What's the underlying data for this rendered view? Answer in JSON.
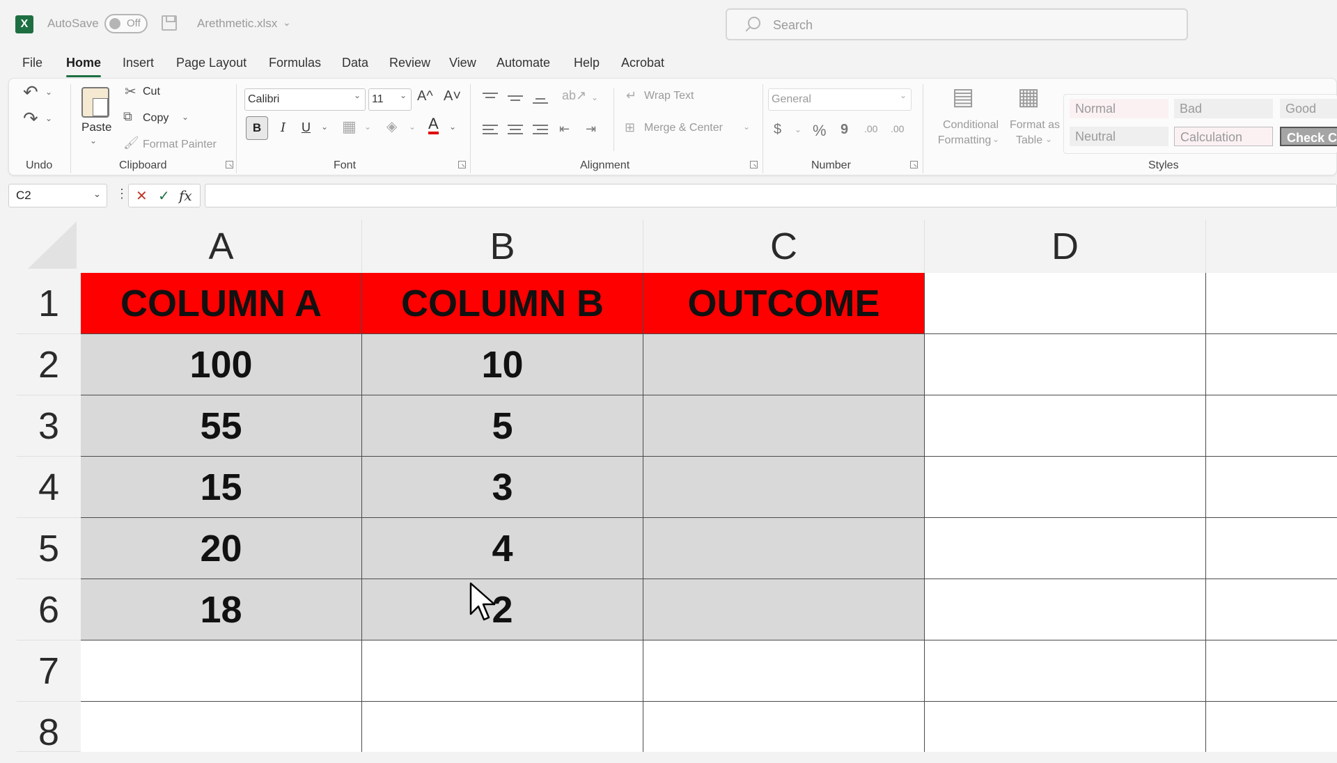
{
  "titlebar": {
    "app_icon_letter": "X",
    "autosave_label": "AutoSave",
    "autosave_state": "Off",
    "filename": "Arethmetic.xlsx",
    "search_placeholder": "Search"
  },
  "menu": {
    "tabs": [
      "File",
      "Home",
      "Insert",
      "Page Layout",
      "Formulas",
      "Data",
      "Review",
      "View",
      "Automate",
      "Help",
      "Acrobat"
    ],
    "active": "Home"
  },
  "ribbon": {
    "undo_group": "Undo",
    "clipboard": {
      "group": "Clipboard",
      "paste": "Paste",
      "cut": "Cut",
      "copy": "Copy",
      "format_painter": "Format Painter"
    },
    "font": {
      "group": "Font",
      "font_name": "Calibri",
      "font_size": "11",
      "bold": "B",
      "italic": "I",
      "underline": "U",
      "grow": "A^",
      "shrink": "A˅",
      "font_color_letter": "A"
    },
    "alignment": {
      "group": "Alignment",
      "wrap_text": "Wrap Text",
      "merge_center": "Merge & Center"
    },
    "number": {
      "group": "Number",
      "format": "General",
      "currency": "$",
      "percent": "%",
      "comma": "9",
      "inc_decimal": ".00",
      "dec_decimal": ".00"
    },
    "styles": {
      "group": "Styles",
      "conditional_formatting": [
        "Conditional",
        "Formatting"
      ],
      "format_as_table": [
        "Format as",
        "Table"
      ],
      "cells": [
        "Normal",
        "Bad",
        "Good",
        "Neutral",
        "Calculation",
        "Check Ce"
      ]
    }
  },
  "formula_bar": {
    "name_box": "C2",
    "dots": "⋮",
    "cancel": "✕",
    "enter": "✓",
    "fx": "fx",
    "value": ""
  },
  "sheet": {
    "columns": [
      "A",
      "B",
      "C",
      "D"
    ],
    "rows": [
      "1",
      "2",
      "3",
      "4",
      "5",
      "6",
      "7",
      "8"
    ],
    "cells": [
      [
        "COLUMN A",
        "COLUMN B",
        "OUTCOME",
        ""
      ],
      [
        "100",
        "10",
        "",
        ""
      ],
      [
        "55",
        "5",
        "",
        ""
      ],
      [
        "15",
        "3",
        "",
        ""
      ],
      [
        "20",
        "4",
        "",
        ""
      ],
      [
        "18",
        "2",
        "",
        ""
      ],
      [
        "",
        "",
        "",
        ""
      ],
      [
        "",
        "",
        "",
        ""
      ]
    ]
  },
  "colors": {
    "header_fill": "#ff0000",
    "data_fill": "#d9d9d9",
    "excel_green": "#1d6f42"
  }
}
